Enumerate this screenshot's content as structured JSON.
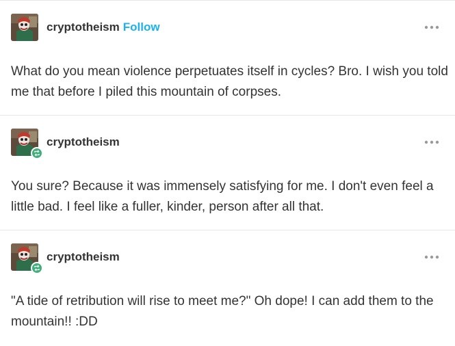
{
  "posts": [
    {
      "username": "cryptotheism",
      "follow_label": "Follow",
      "body": "What do you mean violence perpetuates itself in cycles? Bro. I wish you told me that before I piled this mountain of corpses."
    },
    {
      "username": "cryptotheism",
      "body": "You sure? Because it was immensely satisfying for me. I don't even feel a little bad. I feel like a fuller, kinder, person after all that."
    },
    {
      "username": "cryptotheism",
      "body": "\"A tide of retribution will rise to meet me?\" Oh dope! I can add them to the mountain!! :DD"
    }
  ],
  "icons": {
    "more": "more-options-icon",
    "reblog": "reblog-icon"
  },
  "colors": {
    "follow": "#1ab2f2",
    "reblog_badge": "#3fb07a",
    "divider": "#e6e6e6",
    "text": "#333333"
  }
}
